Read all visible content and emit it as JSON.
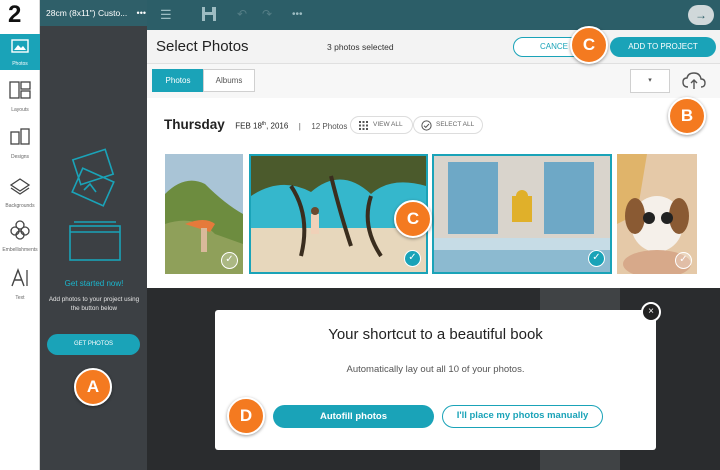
{
  "step_number": "2",
  "project_title": "28cm (8x11\") Custo...",
  "rail": [
    {
      "label": "Photos",
      "icon": "photos-icon"
    },
    {
      "label": "Layouts",
      "icon": "layouts-icon"
    },
    {
      "label": "Designs",
      "icon": "designs-icon"
    },
    {
      "label": "Backgrounds",
      "icon": "backgrounds-icon"
    },
    {
      "label": "Embellishments",
      "icon": "embellishments-icon"
    },
    {
      "label": "Text",
      "icon": "text-icon"
    }
  ],
  "panel": {
    "heading": "Get started now!",
    "text": "Add photos to your project using the button below",
    "button": "GET PHOTOS"
  },
  "select_modal": {
    "title": "Select Photos",
    "selected_count": "3 photos selected",
    "cancel_label": "CANCE",
    "add_label": "ADD TO PROJECT",
    "tabs": [
      "Photos",
      "Albums"
    ],
    "dropdown": "▾",
    "group": {
      "day": "Thursday",
      "date_main": "FEB 18",
      "date_sup": "th",
      "date_year": ", 2016",
      "separator": "|",
      "photo_count": "12 Photos",
      "view_all": "VIEW ALL",
      "select_all": "SELECT ALL"
    }
  },
  "photos": [
    {
      "name": "cliff-hiker",
      "selected": false
    },
    {
      "name": "beach-child",
      "selected": true
    },
    {
      "name": "temple-doors",
      "selected": true
    },
    {
      "name": "dog-sunglasses",
      "selected": false
    }
  ],
  "shortcut": {
    "title": "Your shortcut to a beautiful book",
    "subtitle": "Automatically lay out all 10 of your photos.",
    "autofill_label": "Autofill photos",
    "manual_label": "I'll place my photos manually",
    "close_label": "×"
  },
  "markers": {
    "a": "A",
    "b": "B",
    "c1": "C",
    "c2": "C",
    "d": "D"
  },
  "colors": {
    "accent": "#1aa3b8",
    "marker": "#f47a20",
    "toolbar": "#2c5e68"
  }
}
